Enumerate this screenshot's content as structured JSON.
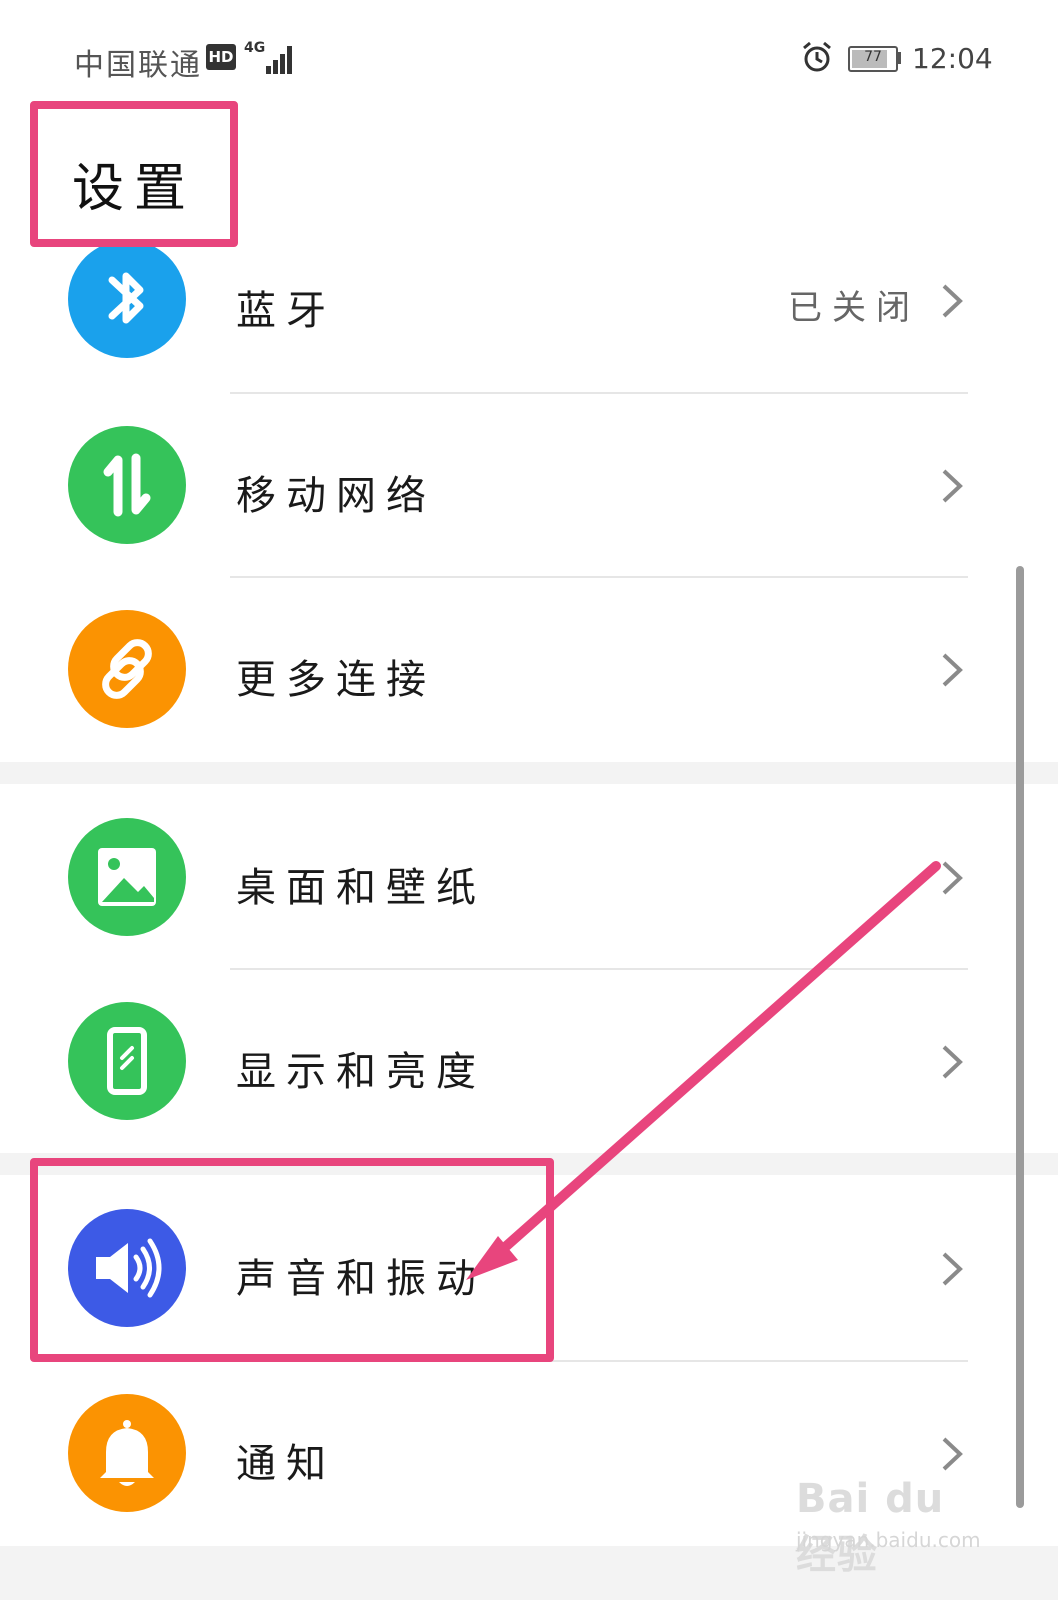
{
  "status_bar": {
    "carrier": "中国联通",
    "hd_badge": "HD",
    "network": "4G",
    "battery": "77",
    "time": "12:04"
  },
  "page_title": "设置",
  "rows": [
    {
      "label": "蓝牙",
      "value": "已关闭",
      "icon": "bluetooth-icon",
      "color": "#1aa1ec"
    },
    {
      "label": "移动网络",
      "value": "",
      "icon": "mobile-data-icon",
      "color": "#35c35a"
    },
    {
      "label": "更多连接",
      "value": "",
      "icon": "link-icon",
      "color": "#fb9302"
    },
    {
      "label": "桌面和壁纸",
      "value": "",
      "icon": "wallpaper-icon",
      "color": "#35c35a"
    },
    {
      "label": "显示和亮度",
      "value": "",
      "icon": "display-icon",
      "color": "#35c35a"
    },
    {
      "label": "声音和振动",
      "value": "",
      "icon": "sound-icon",
      "color": "#3d5ae6"
    },
    {
      "label": "通知",
      "value": "",
      "icon": "bell-icon",
      "color": "#fb9302"
    }
  ],
  "annotation_color": "#e8457d",
  "watermark": {
    "logo": "Bai du 经验",
    "url": "jingyan.baidu.com"
  }
}
